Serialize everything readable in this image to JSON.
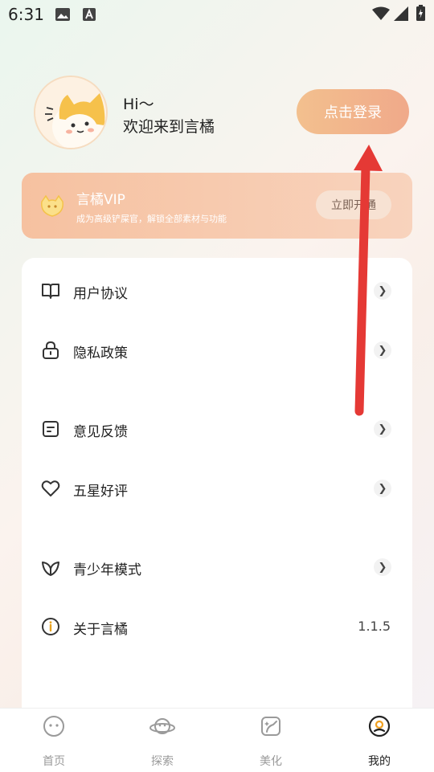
{
  "status_bar": {
    "time": "6:31"
  },
  "profile": {
    "greeting": "Hi～",
    "welcome": "欢迎来到言橘",
    "login_label": "点击登录"
  },
  "vip": {
    "title": "言橘VIP",
    "subtitle": "成为高级铲屎官，解锁全部素材与功能",
    "button_label": "立即开通"
  },
  "menu": [
    {
      "label": "用户协议",
      "icon": "book-icon"
    },
    {
      "label": "隐私政策",
      "icon": "lock-icon"
    },
    {
      "label": "意见反馈",
      "icon": "feedback-icon"
    },
    {
      "label": "五星好评",
      "icon": "heart-icon"
    },
    {
      "label": "青少年模式",
      "icon": "leaf-icon"
    },
    {
      "label": "关于言橘",
      "icon": "info-icon",
      "value": "1.1.5"
    }
  ],
  "tabs": [
    {
      "label": "首页",
      "icon": "home-face-icon"
    },
    {
      "label": "探索",
      "icon": "planet-icon"
    },
    {
      "label": "美化",
      "icon": "sticker-icon"
    },
    {
      "label": "我的",
      "icon": "profile-icon"
    }
  ],
  "colors": {
    "accent": "#f0a98a",
    "vip_bg": "#f6c1a0",
    "arrow": "#e53935"
  }
}
